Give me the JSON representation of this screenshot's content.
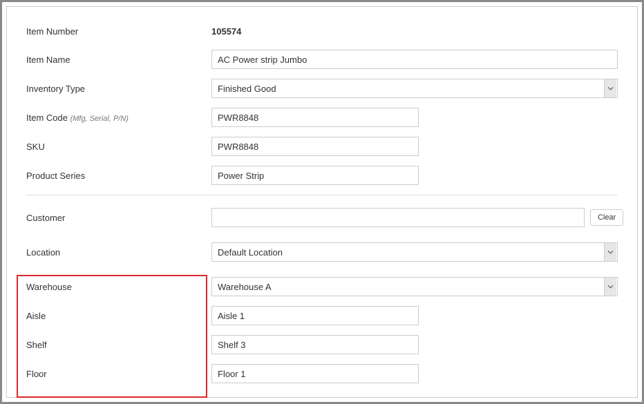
{
  "labels": {
    "item_number": "Item Number",
    "item_name": "Item Name",
    "inventory_type": "Inventory Type",
    "item_code": "Item Code",
    "item_code_hint": "(Mfg, Serial, P/N)",
    "sku": "SKU",
    "product_series": "Product Series",
    "customer": "Customer",
    "location": "Location",
    "warehouse": "Warehouse",
    "aisle": "Aisle",
    "shelf": "Shelf",
    "floor": "Floor"
  },
  "values": {
    "item_number": "105574",
    "item_name": "AC Power strip Jumbo",
    "inventory_type": "Finished Good",
    "item_code": "PWR8848",
    "sku": "PWR8848",
    "product_series": "Power Strip",
    "customer": "",
    "location": "Default Location",
    "warehouse": "Warehouse A",
    "aisle": "Aisle 1",
    "shelf": "Shelf 3",
    "floor": "Floor 1"
  },
  "buttons": {
    "clear": "Clear"
  }
}
